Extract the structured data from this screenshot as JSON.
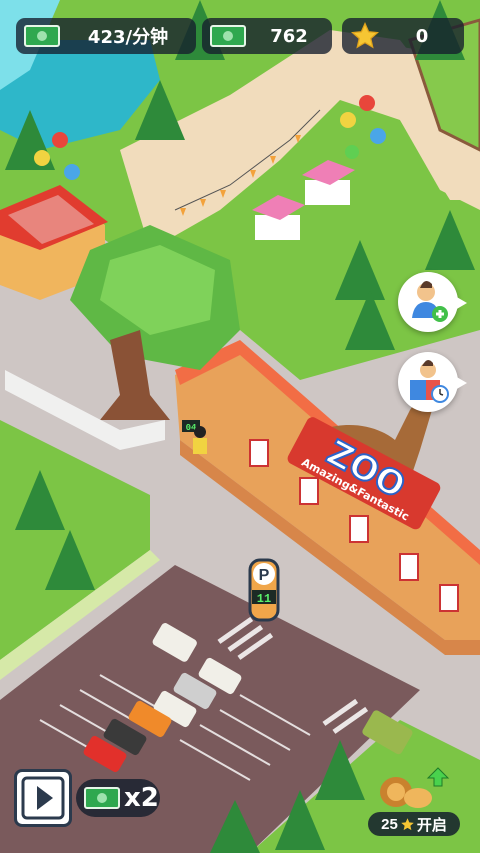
{
  "hud": {
    "income_rate": "423/分钟",
    "money": "762",
    "stars": "0"
  },
  "signs": {
    "zoo_name": "ZOO",
    "zoo_subtitle": "Amazing&Fantastic",
    "parking_letter": "P",
    "parking_count": "11",
    "gate_counter": "04"
  },
  "bottom": {
    "boost_label": "x2",
    "unlock_cost": "25",
    "unlock_label": "开启"
  },
  "icons": {
    "money": "money-bill-icon",
    "star": "star-icon",
    "hire": "add-visitor-icon",
    "schedule": "book-clock-icon",
    "video": "play-video-icon",
    "unlock": "lion-animal-icon"
  },
  "colors": {
    "grass": "#7cc545",
    "path": "#f1dcbc",
    "road": "#cfc6c4",
    "parking": "#7a5a5c",
    "hud_bg": "#1e2d3a",
    "accent_red": "#d8392e"
  }
}
